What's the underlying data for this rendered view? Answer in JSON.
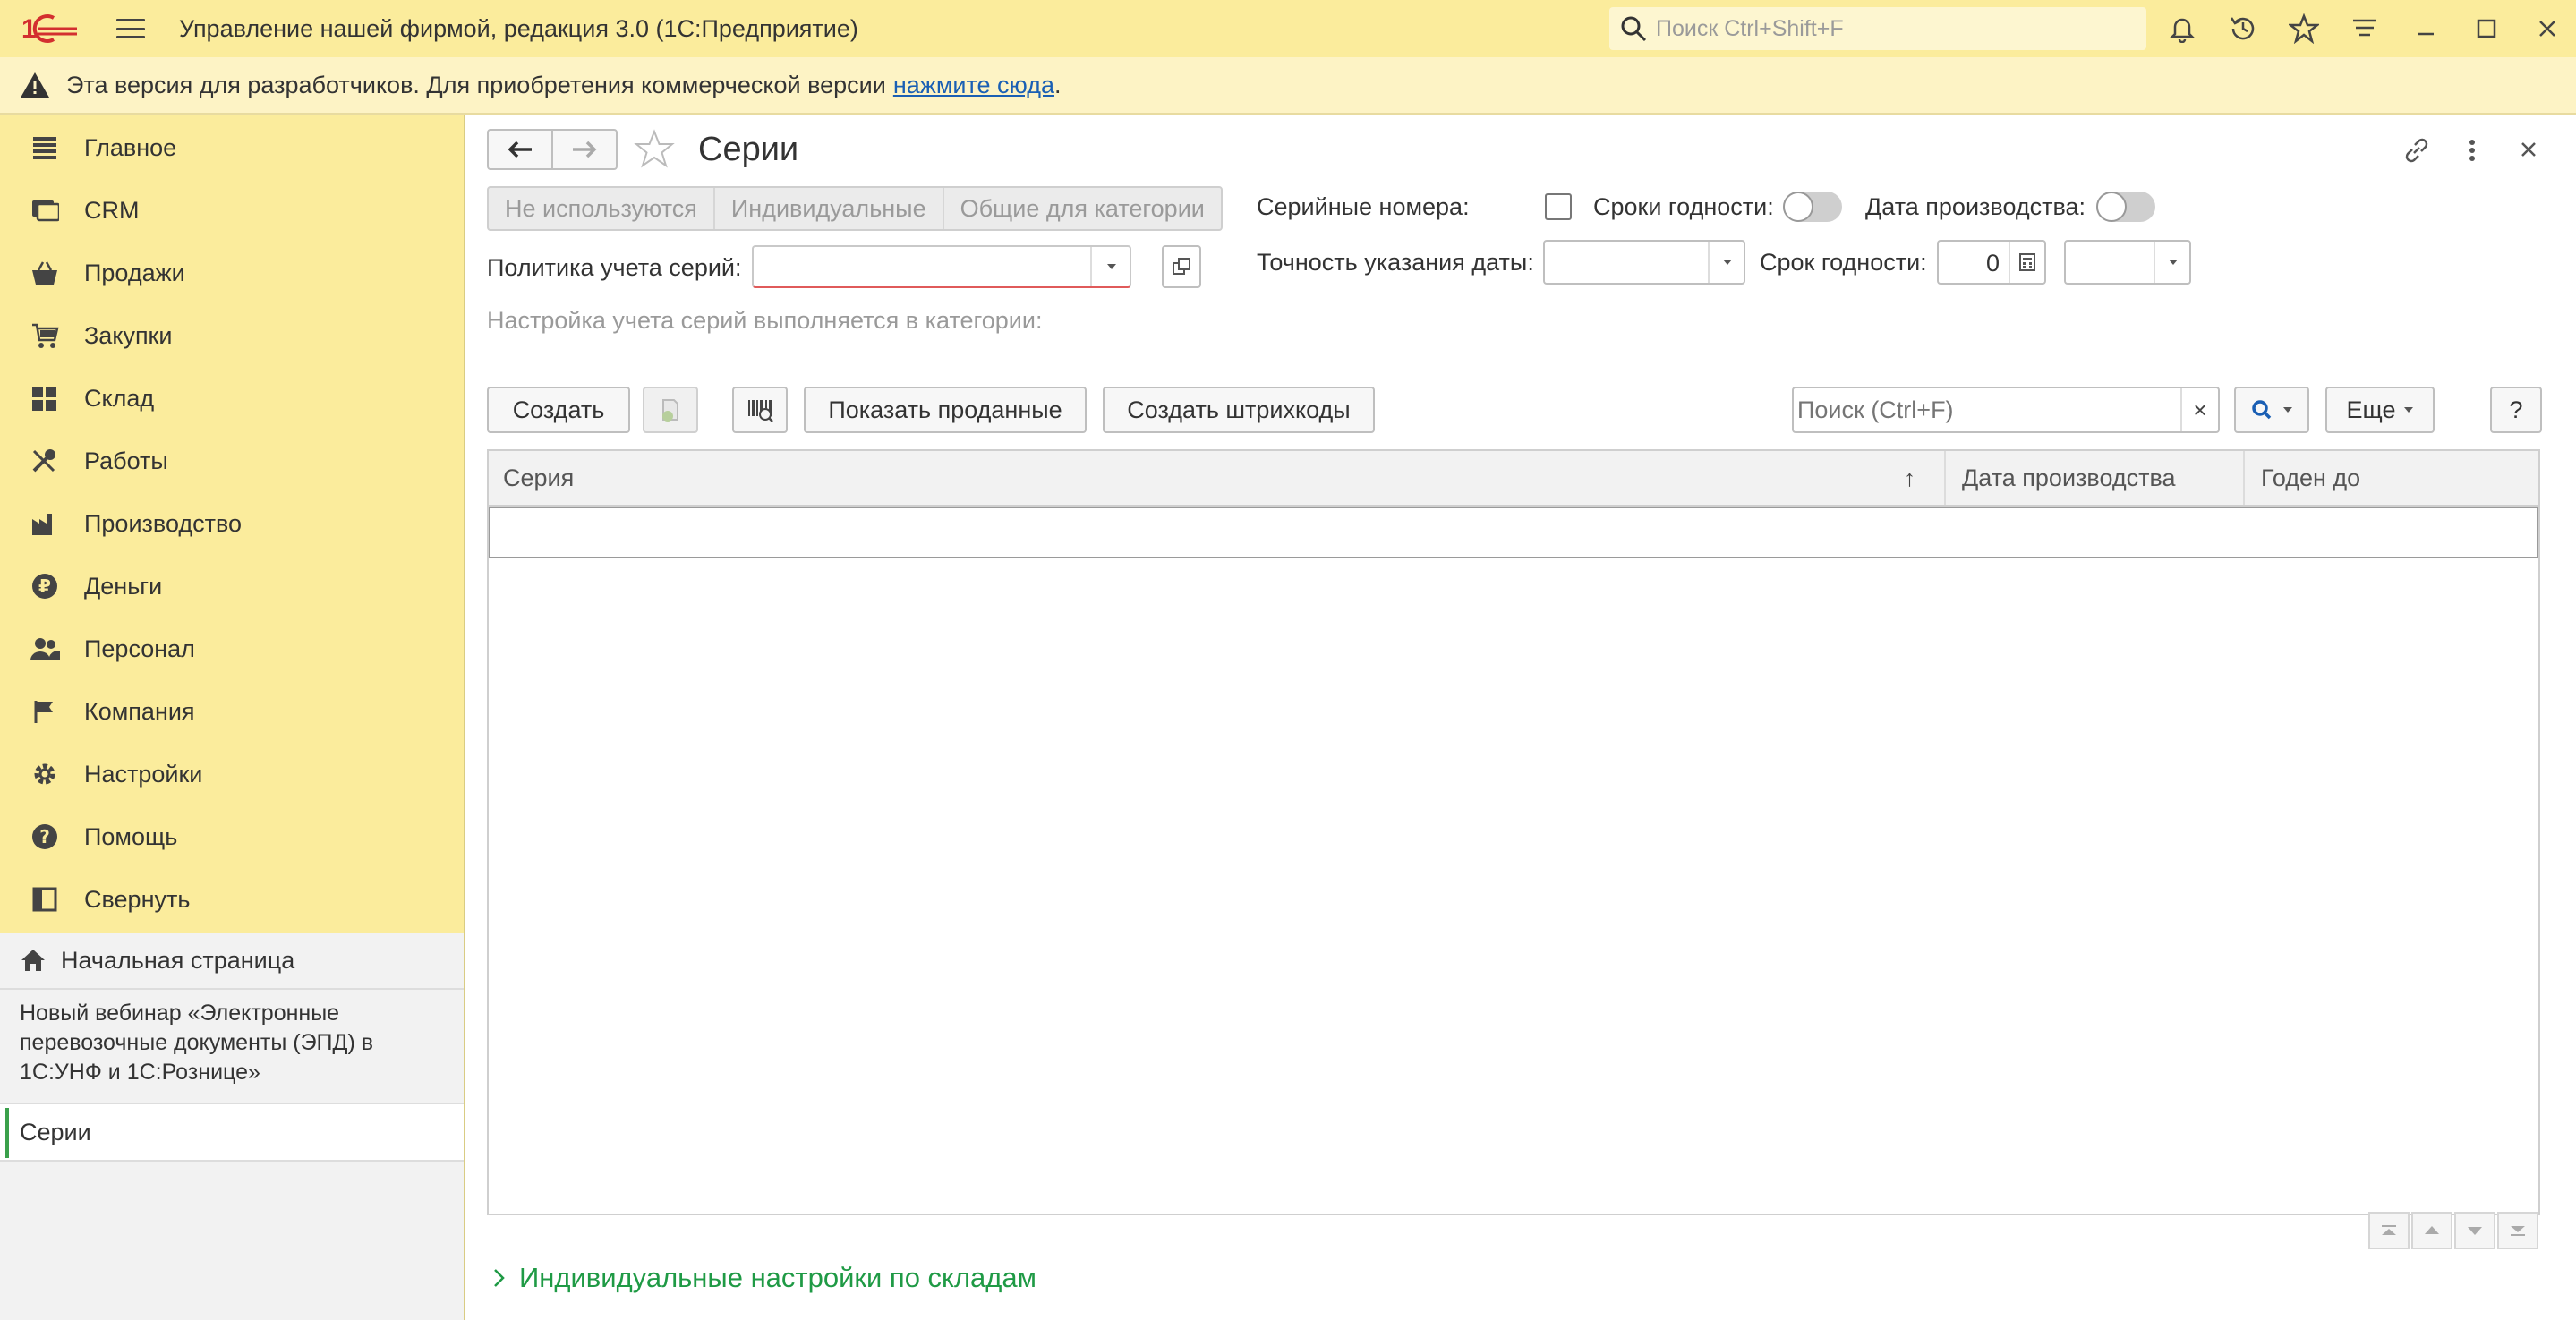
{
  "app": {
    "title": "Управление нашей фирмой, редакция 3.0  (1С:Предприятие)",
    "search_placeholder": "Поиск Ctrl+Shift+F",
    "logo_text": "1С"
  },
  "banner": {
    "message": "Эта версия для разработчиков. Для приобретения коммерческой версии",
    "link": "нажмите сюда",
    "tail": "."
  },
  "sidebar": {
    "items": [
      {
        "label": "Главное",
        "icon": "menu-lines-icon"
      },
      {
        "label": "CRM",
        "icon": "crm-icon"
      },
      {
        "label": "Продажи",
        "icon": "basket-icon"
      },
      {
        "label": "Закупки",
        "icon": "cart-icon"
      },
      {
        "label": "Склад",
        "icon": "warehouse-icon"
      },
      {
        "label": "Работы",
        "icon": "tools-icon"
      },
      {
        "label": "Производство",
        "icon": "factory-icon"
      },
      {
        "label": "Деньги",
        "icon": "ruble-icon"
      },
      {
        "label": "Персонал",
        "icon": "people-icon"
      },
      {
        "label": "Компания",
        "icon": "flag-icon"
      },
      {
        "label": "Настройки",
        "icon": "gear-icon"
      },
      {
        "label": "Помощь",
        "icon": "help-icon"
      },
      {
        "label": "Свернуть",
        "icon": "collapse-panel-icon"
      }
    ],
    "home_label": "Начальная страница",
    "webinar_text": "Новый вебинар «Электронные перевозочные документы (ЭПД) в 1С:УНФ и 1С:Рознице»",
    "open_tab": "Серии"
  },
  "form": {
    "title": "Серии",
    "segments": [
      "Не используются",
      "Индивидуальные",
      "Общие для категории"
    ],
    "policy_label": "Политика учета серий:",
    "policy_value": "",
    "category_note": "Настройка учета серий выполняется в категории:",
    "serial_numbers_label": "Серийные номера:",
    "expiry_label": "Сроки годности:",
    "prod_date_label": "Дата производства:",
    "date_precision_label": "Точность указания даты:",
    "date_precision_value": "",
    "shelf_life_label": "Срок годности:",
    "shelf_life_value": "0",
    "shelf_life_unit": ""
  },
  "toolbar": {
    "create": "Создать",
    "show_sold": "Показать проданные",
    "create_barcodes": "Создать штрихкоды",
    "search_placeholder": "Поиск (Ctrl+F)",
    "clear": "×",
    "more": "Еще",
    "help": "?"
  },
  "table": {
    "columns": [
      "Серия",
      "Дата производства",
      "Годен до"
    ],
    "sort_indicator": "↑",
    "rows": []
  },
  "group": {
    "label": "Индивидуальные настройки по складам"
  },
  "colors": {
    "header_bg": "#fbec9c",
    "banner_bg": "#fdf3c5",
    "accent_green": "#1f9a45",
    "link_blue": "#1a5fb4"
  }
}
